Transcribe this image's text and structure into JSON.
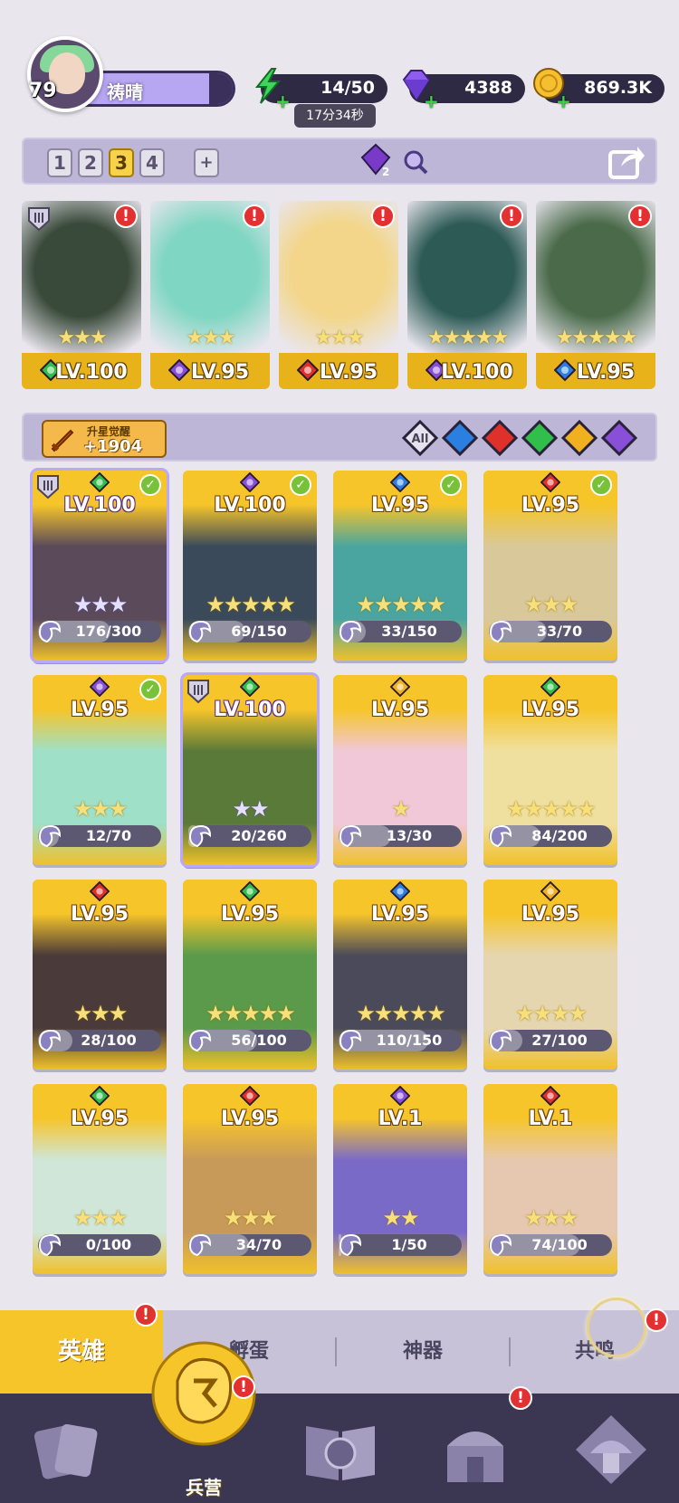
{
  "player": {
    "level": "79",
    "name": "祷晴"
  },
  "resources": {
    "energy": "14/50",
    "energy_timer": "17分34秒",
    "gems": "4388",
    "gold": "869.3K"
  },
  "team": {
    "slots": [
      "1",
      "2",
      "3",
      "4"
    ],
    "active_slot": "3",
    "add_label": "+",
    "gem_badge": "2"
  },
  "deployed": [
    {
      "level": "LV.100",
      "element": "green",
      "stars": "★★★",
      "rank": true,
      "art": "#3a4a3a"
    },
    {
      "level": "LV.95",
      "element": "purple",
      "stars": "★★★",
      "rank": false,
      "art": "#7fd6c2"
    },
    {
      "level": "LV.95",
      "element": "red",
      "stars": "★★★",
      "rank": false,
      "art": "#f3d68a"
    },
    {
      "level": "LV.100",
      "element": "purple",
      "stars": "★★★★★",
      "rank": false,
      "art": "#2d5a55"
    },
    {
      "level": "LV.95",
      "element": "blue",
      "stars": "★★★★★",
      "rank": false,
      "art": "#4a6a4a"
    }
  ],
  "awaken": {
    "label": "升星觉醒",
    "value": "+1904"
  },
  "filters": [
    {
      "id": "all",
      "label": "All"
    },
    {
      "id": "water",
      "label": ""
    },
    {
      "id": "fire",
      "label": ""
    },
    {
      "id": "nature",
      "label": ""
    },
    {
      "id": "light",
      "label": ""
    },
    {
      "id": "dark",
      "label": ""
    }
  ],
  "heroes": [
    {
      "level": "LV.100",
      "element": "green",
      "stars": "★★★",
      "shards": "176/300",
      "fill": 0.59,
      "check": true,
      "purple": true,
      "rank": true,
      "art": "#5a4a5a"
    },
    {
      "level": "LV.100",
      "element": "purple",
      "stars": "★★★★★",
      "shards": "69/150",
      "fill": 0.46,
      "check": true,
      "purple": false,
      "rank": false,
      "art": "#3a4a5a"
    },
    {
      "level": "LV.95",
      "element": "blue",
      "stars": "★★★★★",
      "shards": "33/150",
      "fill": 0.22,
      "check": true,
      "purple": false,
      "rank": false,
      "art": "#4aa5a0"
    },
    {
      "level": "LV.95",
      "element": "red",
      "stars": "★★★",
      "shards": "33/70",
      "fill": 0.47,
      "check": true,
      "purple": false,
      "rank": false,
      "art": "#d9c89a"
    },
    {
      "level": "LV.95",
      "element": "purple",
      "stars": "★★★",
      "shards": "12/70",
      "fill": 0.17,
      "check": true,
      "purple": false,
      "rank": false,
      "art": "#9fe0c8"
    },
    {
      "level": "LV.100",
      "element": "green",
      "stars": "★★",
      "shards": "20/260",
      "fill": 0.08,
      "check": false,
      "purple": true,
      "rank": true,
      "art": "#5a7a3a"
    },
    {
      "level": "LV.95",
      "element": "yellow",
      "stars": "★",
      "shards": "13/30",
      "fill": 0.43,
      "check": false,
      "purple": false,
      "rank": false,
      "art": "#f0c8d8"
    },
    {
      "level": "LV.95",
      "element": "green",
      "stars": "★★★★★",
      "shards": "84/200",
      "fill": 0.42,
      "check": false,
      "purple": false,
      "rank": false,
      "art": "#f0e0a0"
    },
    {
      "level": "LV.95",
      "element": "red",
      "stars": "★★★",
      "shards": "28/100",
      "fill": 0.28,
      "check": false,
      "purple": false,
      "rank": false,
      "art": "#4a3a3a"
    },
    {
      "level": "LV.95",
      "element": "green",
      "stars": "★★★★★",
      "shards": "56/100",
      "fill": 0.56,
      "check": false,
      "purple": false,
      "rank": false,
      "art": "#5a9a4a"
    },
    {
      "level": "LV.95",
      "element": "blue",
      "stars": "★★★★★",
      "shards": "110/150",
      "fill": 0.73,
      "check": false,
      "purple": false,
      "rank": false,
      "art": "#4a4a5a"
    },
    {
      "level": "LV.95",
      "element": "yellow",
      "stars": "★★★★",
      "shards": "27/100",
      "fill": 0.27,
      "check": false,
      "purple": false,
      "rank": false,
      "art": "#e6d6b0"
    },
    {
      "level": "LV.95",
      "element": "green",
      "stars": "★★★",
      "shards": "0/100",
      "fill": 0.0,
      "check": false,
      "purple": false,
      "rank": false,
      "art": "#cfe6d8"
    },
    {
      "level": "LV.95",
      "element": "red",
      "stars": "★★★",
      "shards": "34/70",
      "fill": 0.49,
      "check": false,
      "purple": false,
      "rank": false,
      "art": "#c89a5a"
    },
    {
      "level": "LV.1",
      "element": "purple",
      "stars": "★★",
      "shards": "1/50",
      "fill": 0.02,
      "check": false,
      "purple": false,
      "rank": false,
      "art": "#7a6ac8"
    },
    {
      "level": "LV.1",
      "element": "red",
      "stars": "★★★",
      "shards": "74/100",
      "fill": 0.74,
      "check": false,
      "purple": false,
      "rank": false,
      "art": "#e6c8b0"
    }
  ],
  "sub_tabs": [
    {
      "id": "heroes",
      "label": "英雄",
      "active": true,
      "alert": "!"
    },
    {
      "id": "hatch",
      "label": "孵蛋",
      "active": false
    },
    {
      "id": "artifact",
      "label": "神器",
      "active": false
    },
    {
      "id": "resonance",
      "label": "共鸣",
      "active": false,
      "alert": "!"
    }
  ],
  "nav": {
    "barracks_label": "兵营",
    "alert": "!"
  },
  "colors": {
    "element_green": "#2fbf4a",
    "element_purple": "#8a4fd8",
    "element_red": "#e0302a",
    "element_blue": "#2a7fe0",
    "element_yellow": "#f0b020",
    "accent_gold": "#f6c52a"
  }
}
